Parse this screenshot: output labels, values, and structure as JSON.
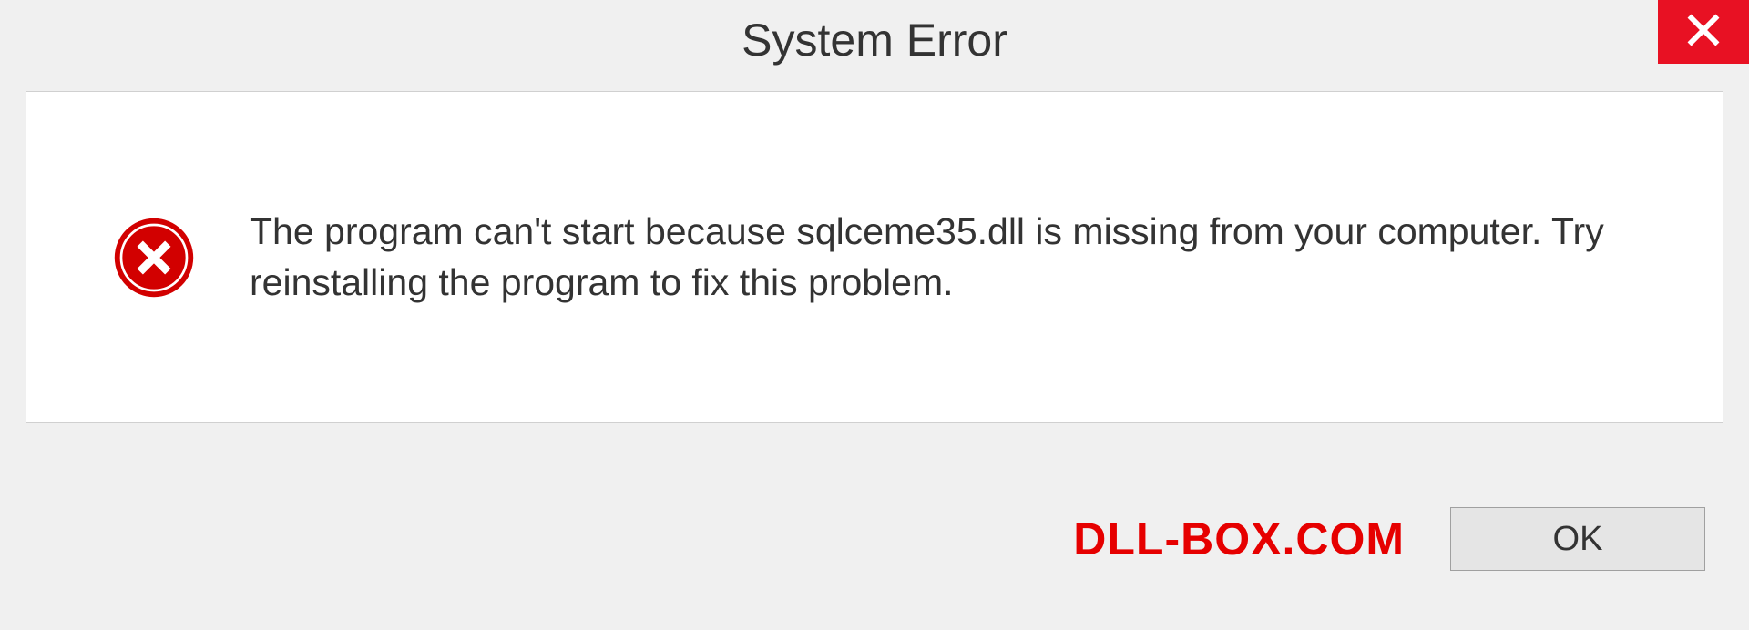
{
  "dialog": {
    "title": "System Error",
    "message": "The program can't start because sqlceme35.dll is missing from your computer. Try reinstalling the program to fix this problem.",
    "ok_label": "OK"
  },
  "watermark": "DLL-BOX.COM",
  "colors": {
    "close_bg": "#e81123",
    "error_icon": "#d20000",
    "watermark": "#e60000"
  }
}
